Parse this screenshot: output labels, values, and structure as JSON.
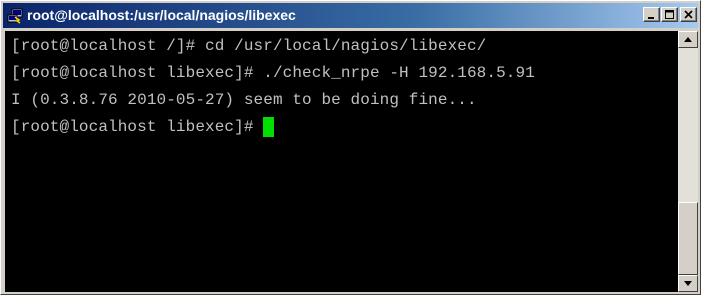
{
  "window": {
    "title": "root@localhost:/usr/local/nagios/libexec",
    "app_icon": "putty-icon",
    "buttons": {
      "minimize_icon": "minimize-icon",
      "maximize_icon": "maximize-icon",
      "close_icon": "close-icon"
    }
  },
  "terminal": {
    "lines": [
      "[root@localhost /]# cd /usr/local/nagios/libexec/",
      "[root@localhost libexec]# ./check_nrpe -H 192.168.5.91",
      "I (0.3.8.76 2010-05-27) seem to be doing fine...",
      "[root@localhost libexec]# "
    ],
    "colors": {
      "background": "#000000",
      "text": "#c0c0c0",
      "cursor": "#00e000"
    }
  },
  "scrollbar": {
    "thumb_start": 0.68,
    "thumb_size": 0.32
  }
}
